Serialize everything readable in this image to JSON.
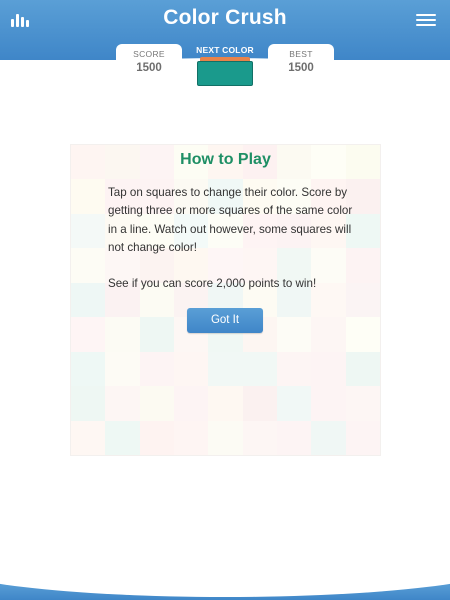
{
  "app": {
    "title": "Color Crush"
  },
  "scoreboard": {
    "score_label": "SCORE",
    "score_value": "1500",
    "next_label": "NEXT COLOR",
    "best_label": "BEST",
    "best_value": "1500"
  },
  "next_color": {
    "primary": "#1a9a8c",
    "secondary": "#e8834a"
  },
  "board": {
    "rows": 9,
    "cols": 9,
    "cells": [
      "#fef5f2",
      "#fcf7f1",
      "#fdf4f4",
      "#fdfdf4",
      "#fef6f1",
      "#fdf1f1",
      "#fcfaf2",
      "#fefef6",
      "#fcfcf0",
      "#fefbf1",
      "#fdf3f3",
      "#fdf3f3",
      "#fcfaf3",
      "#f0f8f6",
      "#fefbf2",
      "#fdfdf5",
      "#fef4f2",
      "#fbf1f0",
      "#f4f9f7",
      "#fdfaf3",
      "#fdfdf5",
      "#f3faf8",
      "#fdfdf6",
      "#fef4f4",
      "#fcf3f3",
      "#fef7f3",
      "#eef8f4",
      "#fdfcf5",
      "#fdf7f5",
      "#fcf3f1",
      "#fef8f1",
      "#fef6f6",
      "#fef6f4",
      "#f1f8f4",
      "#fdfcf6",
      "#fdf3f3",
      "#eef7f5",
      "#fbf2f2",
      "#fcfbf3",
      "#fbf3f2",
      "#f0f7f5",
      "#fdfbf3",
      "#f0f7f5",
      "#fef8f4",
      "#fbf4f4",
      "#fef5f5",
      "#fcfbf4",
      "#eef7f3",
      "#fdf7f4",
      "#f0f8f4",
      "#fdf6f2",
      "#fdfcf6",
      "#fdf6f4",
      "#fefef6",
      "#eef8f5",
      "#fdfbf5",
      "#fdf4f4",
      "#fef6f3",
      "#f1f8f5",
      "#f1f8f5",
      "#fdf5f4",
      "#fdf4f4",
      "#eef7f3",
      "#eef7f3",
      "#fdf6f4",
      "#fcfaf2",
      "#fdf4f4",
      "#fef8f2",
      "#fbf1f0",
      "#f1f8f6",
      "#fdf4f4",
      "#fdf6f4",
      "#fef7f3",
      "#eef8f4",
      "#fef3f1",
      "#fef5f3",
      "#fcfbf4",
      "#fdf6f4",
      "#fdf4f4",
      "#f0f7f5",
      "#fdf4f4"
    ]
  },
  "dialog": {
    "title": "How to Play",
    "paragraph1": "Tap on squares to change their color. Score by getting three or more squares of the same color in a line. Watch out however, some squares will not change color!",
    "paragraph2": "See if you can score 2,000 points to win!",
    "button_label": "Got It"
  },
  "colors": {
    "header": "#4a92cf",
    "title_green": "#1e8f65",
    "button": "#4a92cf"
  },
  "icons": {
    "left": "bar-chart-icon",
    "right": "hamburger-menu-icon"
  }
}
